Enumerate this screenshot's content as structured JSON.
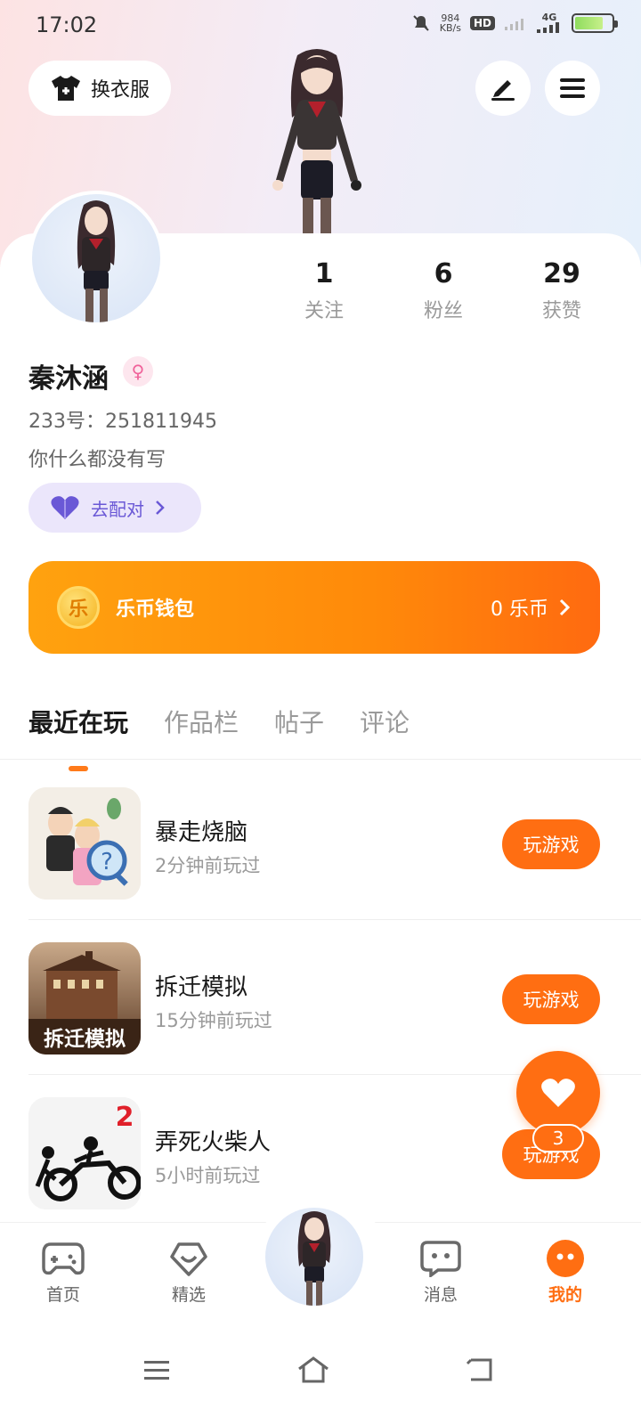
{
  "status_bar": {
    "time": "17:02",
    "net_speed": "984",
    "net_unit": "KB/s",
    "hd": "HD",
    "network": "4G"
  },
  "header": {
    "dress_label": "换衣服"
  },
  "profile": {
    "stats": [
      {
        "value": "1",
        "label": "关注"
      },
      {
        "value": "6",
        "label": "粉丝"
      },
      {
        "value": "29",
        "label": "获赞"
      }
    ],
    "name": "秦沐涵",
    "gender_symbol": "♀",
    "uid": "233号：251811945",
    "bio": "你什么都没有写",
    "match_label": "去配对"
  },
  "wallet": {
    "coin_char": "乐",
    "title": "乐币钱包",
    "amount": "0 乐币"
  },
  "tabs": [
    "最近在玩",
    "作品栏",
    "帖子",
    "评论"
  ],
  "games": [
    {
      "name": "暴走烧脑",
      "time": "2分钟前玩过",
      "play": "玩游戏"
    },
    {
      "name": "拆迁模拟",
      "time": "15分钟前玩过",
      "play": "玩游戏",
      "thumb_text": "拆迁模拟"
    },
    {
      "name": "弄死火柴人",
      "time": "5小时前玩过",
      "play": "玩游戏",
      "thumb_badge": "2"
    }
  ],
  "fab": {
    "badge": "3"
  },
  "bottom_nav": [
    {
      "label": "首页"
    },
    {
      "label": "精选"
    },
    {
      "label": "消息"
    },
    {
      "label": "我的"
    }
  ],
  "colors": {
    "accent": "#ff6e12",
    "match": "#6a58d6"
  }
}
